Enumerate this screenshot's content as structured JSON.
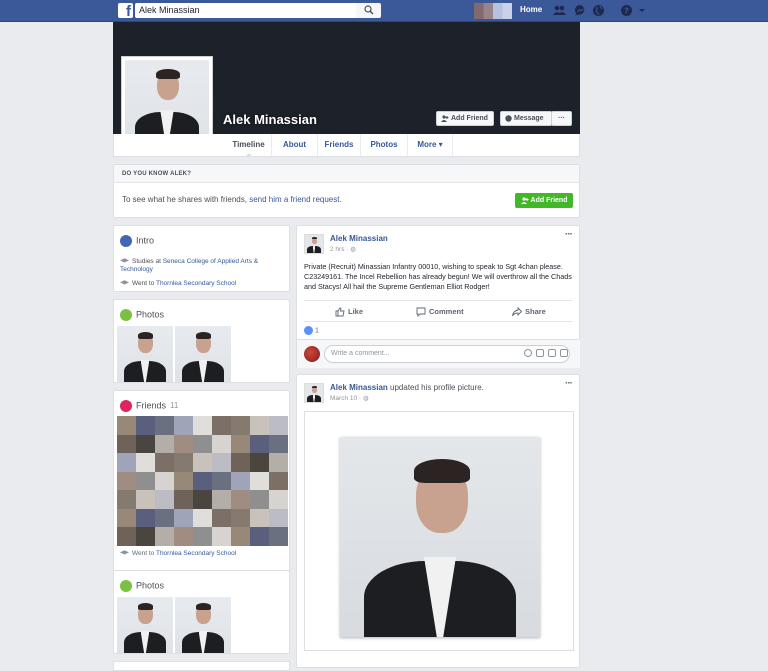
{
  "topbar": {
    "logo": "f",
    "search_value": "Alek Minassian",
    "home_label": "Home",
    "icons": [
      "search-icon",
      "friend-requests-icon",
      "messenger-icon",
      "globe-icon",
      "help-icon",
      "caret-down-icon"
    ]
  },
  "profile": {
    "name": "Alek Minassian",
    "add_friend_label": "Add Friend",
    "message_label": "Message",
    "more_label": "···"
  },
  "tabs": [
    {
      "label": "Timeline"
    },
    {
      "label": "About"
    },
    {
      "label": "Friends"
    },
    {
      "label": "Photos"
    },
    {
      "label": "More ▾"
    }
  ],
  "know": {
    "heading": "DO YOU KNOW ALEK?",
    "text": "To see what he shares with friends, ",
    "link": "send him a friend request.",
    "button": "Add Friend"
  },
  "intro": {
    "title": "Intro",
    "studies_prefix": "Studies at ",
    "studies_link": "Seneca College of Applied Arts & Technology",
    "went_prefix": "Went to ",
    "went_link": "Thornlea Secondary School"
  },
  "photos": {
    "title": "Photos"
  },
  "friends": {
    "title": "Friends",
    "count": "11",
    "footer_prefix": "Went to ",
    "footer_link": "Thornlea Secondary School"
  },
  "photos2": {
    "title": "Photos"
  },
  "post1": {
    "author": "Alek Minassian",
    "time": "2 hrs · ",
    "text": "Private (Recruit) Minassian Infantry 00010, wishing to speak to Sgt 4chan please. C23249161. The Incel Rebellion has already begun! We will overthrow all the Chads and Stacys! All hail the Supreme Gentleman Elliot Rodger!",
    "like_label": "Like",
    "comment_label": "Comment",
    "share_label": "Share",
    "reaction_count": "1",
    "comment_placeholder": "Write a comment..."
  },
  "post2": {
    "author": "Alek Minassian",
    "action": " updated his profile picture.",
    "time": "March 10 · "
  },
  "colors": {
    "brand": "#3b5998",
    "link": "#365899",
    "green": "#42b72a",
    "cover": "#1d2129"
  }
}
